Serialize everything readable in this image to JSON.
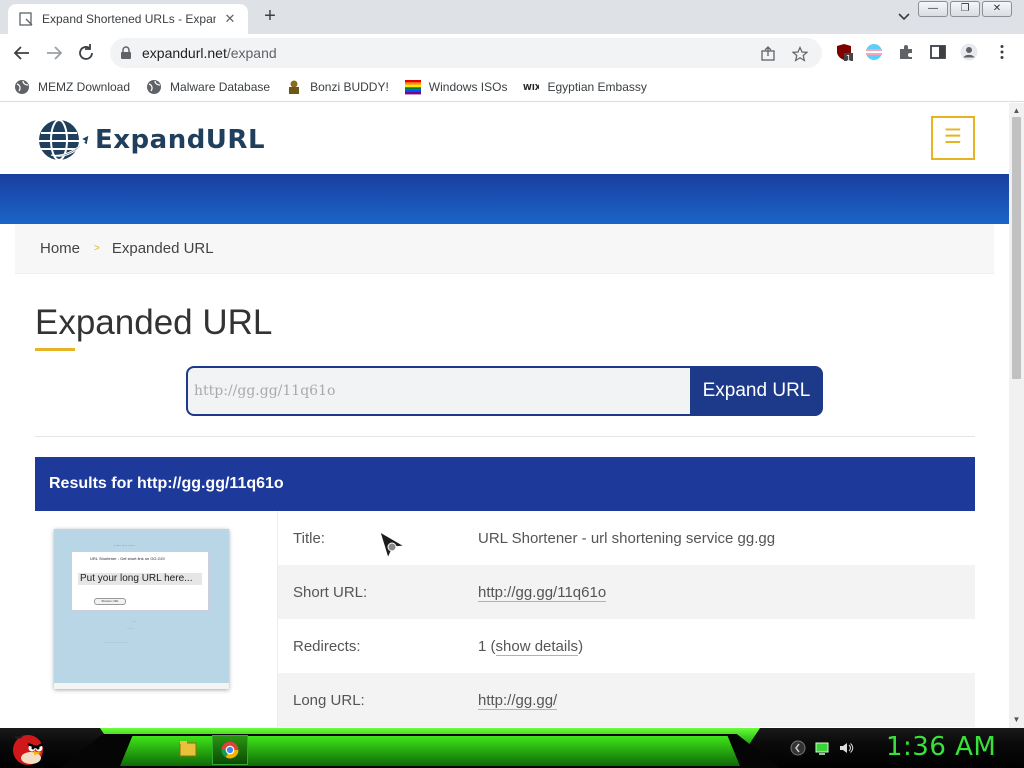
{
  "browser": {
    "tab_title": "Expand Shortened URLs - Expand",
    "url_host": "expandurl.net",
    "url_path": "/expand",
    "window_buttons": [
      "—",
      "❐",
      "✕"
    ],
    "bookmarks": [
      {
        "label": "MEMZ Download",
        "icon": "globe-icon"
      },
      {
        "label": "Malware Database",
        "icon": "globe-icon"
      },
      {
        "label": "Bonzi BUDDY!",
        "icon": "bonzi-icon"
      },
      {
        "label": "Windows ISOs",
        "icon": "windows-flag-icon"
      },
      {
        "label": "Egyptian Embassy",
        "icon": "wix-icon"
      }
    ],
    "extension_badge": "1"
  },
  "site": {
    "logo_text": "ExpandURL",
    "menu_icon": "☰",
    "breadcrumb": {
      "home": "Home",
      "separator": ">",
      "current": "Expanded URL"
    },
    "page_title": "Expanded URL",
    "search": {
      "placeholder": "http://gg.gg/11q61o",
      "button_label": "Expand URL"
    },
    "results_heading": "Results for http://gg.gg/11q61o",
    "thumbnail": {
      "box_title": "URL Shortener - Get short link on GG.GG!",
      "field_text": "Put your long URL here...",
      "button_text": "Shorten URL"
    },
    "rows": [
      {
        "label": "Title:",
        "value": "URL Shortener - url shortening service gg.gg"
      },
      {
        "label": "Short URL:",
        "value": "http://gg.gg/11q61o"
      },
      {
        "label": "Redirects:",
        "value_prefix": "1 (",
        "value_link": "show details",
        "value_suffix": ")"
      },
      {
        "label": "Long URL:",
        "value": "http://gg.gg/"
      }
    ]
  },
  "taskbar": {
    "clock": "1:36 AM",
    "accent_color": "#39e23a"
  }
}
